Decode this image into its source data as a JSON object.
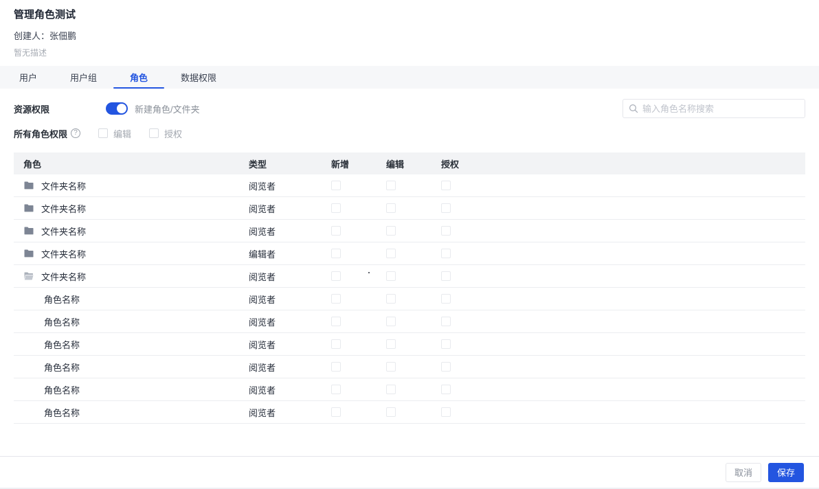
{
  "page": {
    "title": "管理角色测试",
    "creator": "创建人：张佃鹏",
    "description": "暂无描述"
  },
  "tabs": [
    {
      "key": "users",
      "label": "用户",
      "active": false
    },
    {
      "key": "user-groups",
      "label": "用户组",
      "active": false
    },
    {
      "key": "roles",
      "label": "角色",
      "active": true
    },
    {
      "key": "data-permissions",
      "label": "数据权限",
      "active": false
    }
  ],
  "toolbar": {
    "resource_permission_label": "资源权限",
    "toggle": {
      "name": "new-role-folder-toggle",
      "on": true
    },
    "toggle_label": "新建角色/文件夹",
    "all_roles_label": "所有角色权限",
    "help_icon": "question-circle-icon",
    "all_roles_checkboxes": [
      {
        "label": "编辑",
        "checked": false
      },
      {
        "label": "授权",
        "checked": false
      }
    ],
    "search": {
      "placeholder": "输入角色名称搜索",
      "value": "",
      "icon": "search-icon"
    }
  },
  "table": {
    "columns": [
      "角色",
      "类型",
      "新增",
      "编辑",
      "授权"
    ],
    "rows": [
      {
        "kind": "folder",
        "icon": "folder-closed-icon",
        "name": "文件夹名称",
        "type": "阅览者",
        "checks": [
          false,
          false,
          false
        ]
      },
      {
        "kind": "folder",
        "icon": "folder-closed-icon",
        "name": "文件夹名称",
        "type": "阅览者",
        "checks": [
          false,
          false,
          false
        ]
      },
      {
        "kind": "folder",
        "icon": "folder-closed-icon",
        "name": "文件夹名称",
        "type": "阅览者",
        "checks": [
          false,
          false,
          false
        ]
      },
      {
        "kind": "folder",
        "icon": "folder-closed-icon",
        "name": "文件夹名称",
        "type": "编辑者",
        "checks": [
          false,
          false,
          false
        ]
      },
      {
        "kind": "folder",
        "icon": "folder-open-icon",
        "name": "文件夹名称",
        "type": "阅览者",
        "checks": [
          false,
          false,
          false
        ]
      },
      {
        "kind": "role",
        "icon": "",
        "name": "角色名称",
        "type": "阅览者",
        "checks": [
          false,
          false,
          false
        ]
      },
      {
        "kind": "role",
        "icon": "",
        "name": "角色名称",
        "type": "阅览者",
        "checks": [
          false,
          false,
          false
        ]
      },
      {
        "kind": "role",
        "icon": "",
        "name": "角色名称",
        "type": "阅览者",
        "checks": [
          false,
          false,
          false
        ]
      },
      {
        "kind": "role",
        "icon": "",
        "name": "角色名称",
        "type": "阅览者",
        "checks": [
          false,
          false,
          false
        ]
      },
      {
        "kind": "role",
        "icon": "",
        "name": "角色名称",
        "type": "阅览者",
        "checks": [
          false,
          false,
          false
        ]
      },
      {
        "kind": "role",
        "icon": "",
        "name": "角色名称",
        "type": "阅览者",
        "checks": [
          false,
          false,
          false
        ]
      }
    ]
  },
  "footer": {
    "cancel_label": "取消",
    "save_label": "保存"
  },
  "colors": {
    "primary": "#2355e0",
    "text_primary": "#272e3b",
    "text_secondary": "#8a9099",
    "border": "#e5e6eb",
    "table_header_bg": "#f2f3f5",
    "tabbar_bg": "#f6f7f9"
  }
}
